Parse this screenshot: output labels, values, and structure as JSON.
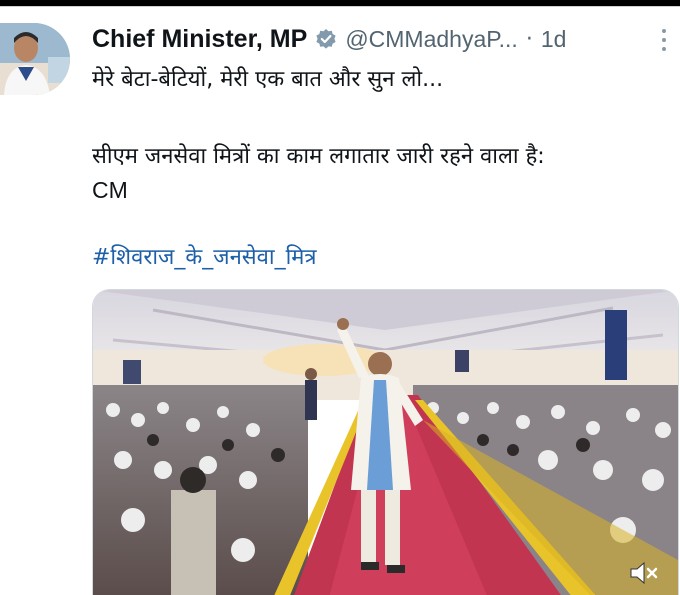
{
  "tweet": {
    "author_name": "Chief Minister, MP",
    "handle": "@CMMadhyaP...",
    "separator": "·",
    "time": "1d",
    "text_line1": "मेरे बेटा-बेटियों, मेरी एक बात और सुन लो...",
    "text_line2": "सीएम जनसेवा मित्रों का काम लगातार जारी रहने वाला है:",
    "text_line3": "CM",
    "hashtag": "#शिवराज_के_जनसेवा_मित्र"
  },
  "icons": {
    "verified": "verified-badge-icon",
    "more": "more-options-icon",
    "mute": "volume-muted-icon"
  },
  "colors": {
    "verified_badge": "#829aab",
    "hashtag": "#1d5fa8",
    "carpet": "#c23550",
    "tent_ceiling": "#e9e7ec",
    "railing": "#e8c42a"
  }
}
